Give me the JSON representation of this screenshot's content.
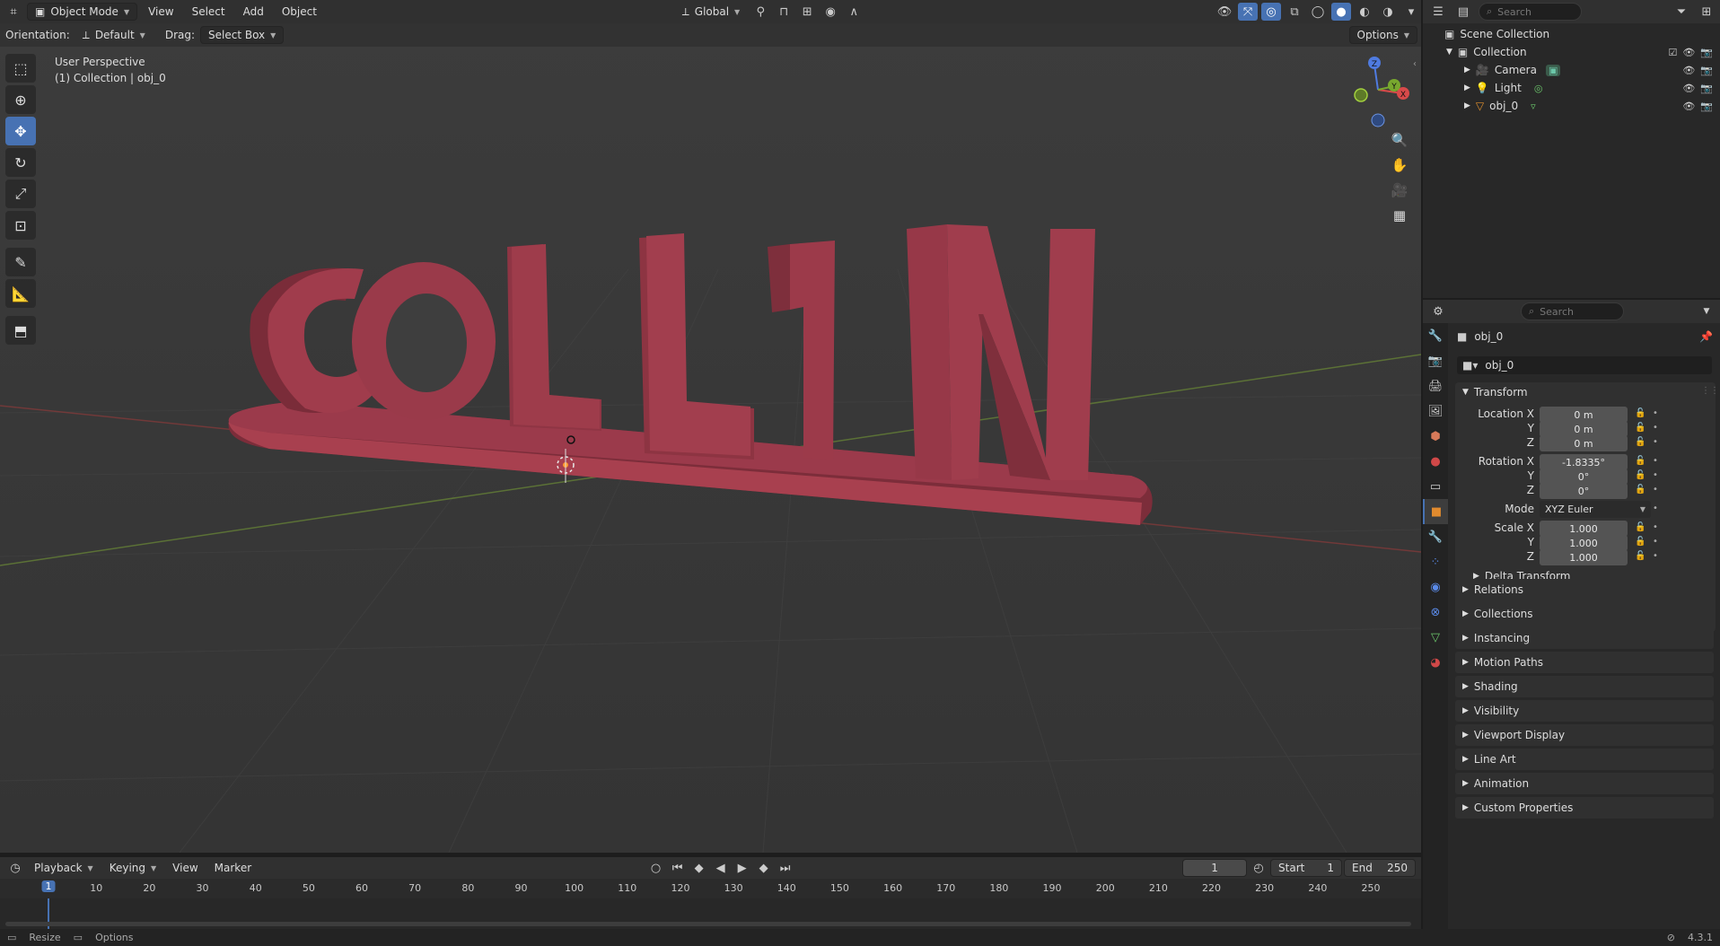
{
  "viewport_header": {
    "mode": "Object Mode",
    "menus": [
      "View",
      "Select",
      "Add",
      "Object"
    ],
    "transform_orientation": "Global"
  },
  "tool_header": {
    "orientation_label": "Orientation:",
    "orientation_value": "Default",
    "drag_label": "Drag:",
    "drag_value": "Select Box",
    "options_label": "Options"
  },
  "overlay": {
    "view_name": "User Perspective",
    "context": "(1) Collection | obj_0"
  },
  "scene": {
    "text_object": "COLLIN",
    "object_color": "#8f3544",
    "base_color": "#9a3a4a"
  },
  "outliner": {
    "search_placeholder": "Search",
    "scene_collection": "Scene Collection",
    "collection": "Collection",
    "items": [
      {
        "name": "Camera",
        "icon": "camera-icon"
      },
      {
        "name": "Light",
        "icon": "light-icon"
      },
      {
        "name": "obj_0",
        "icon": "mesh-icon"
      }
    ]
  },
  "properties": {
    "search_placeholder": "Search",
    "object_name": "obj_0",
    "datablock_name": "obj_0",
    "transform_label": "Transform",
    "location_label": "Location X",
    "location": {
      "x": "0 m",
      "y": "0 m",
      "z": "0 m"
    },
    "rotation_label": "Rotation X",
    "rotation": {
      "x": "-1.8335°",
      "y": "0°",
      "z": "0°"
    },
    "mode_label": "Mode",
    "mode_value": "XYZ Euler",
    "scale_label": "Scale X",
    "scale": {
      "x": "1.000",
      "y": "1.000",
      "z": "1.000"
    },
    "axis_y": "Y",
    "axis_z": "Z",
    "delta_transform": "Delta Transform",
    "panels": [
      "Relations",
      "Collections",
      "Instancing",
      "Motion Paths",
      "Shading",
      "Visibility",
      "Viewport Display",
      "Line Art",
      "Animation",
      "Custom Properties"
    ]
  },
  "timeline": {
    "menus": [
      "Playback",
      "Keying",
      "View",
      "Marker"
    ],
    "current_frame": "1",
    "start_label": "Start",
    "start": "1",
    "end_label": "End",
    "end": "250",
    "ticks": [
      "1",
      "10",
      "20",
      "30",
      "40",
      "50",
      "60",
      "70",
      "80",
      "90",
      "100",
      "110",
      "120",
      "130",
      "140",
      "150",
      "160",
      "170",
      "180",
      "190",
      "200",
      "210",
      "220",
      "230",
      "240",
      "250"
    ]
  },
  "status_bar": {
    "resize": "Resize",
    "options": "Options",
    "version": "4.3.1"
  }
}
